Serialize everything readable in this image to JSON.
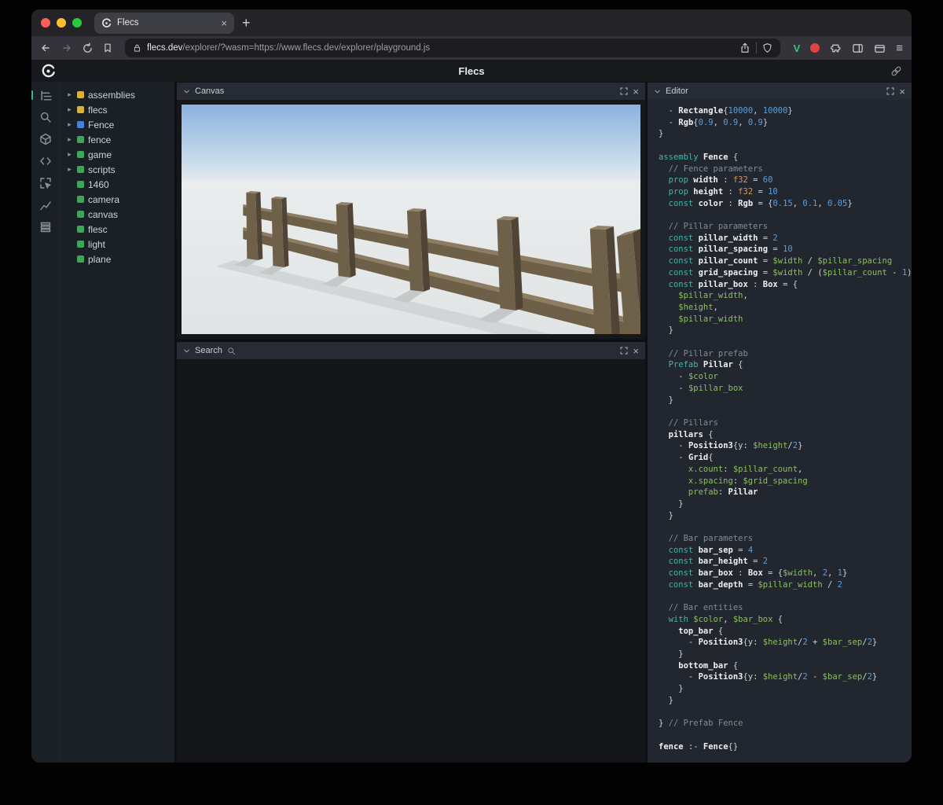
{
  "colors": {
    "traffic_close": "#ff5f57",
    "traffic_min": "#febc2e",
    "traffic_max": "#28c840",
    "keyword": "#45b3a7",
    "variable": "#8cbf5f",
    "number": "#5d9edb",
    "comment": "#848b93",
    "type": "#cf9a5f",
    "plain": "#ccd2d9",
    "bold": "#eef1f4",
    "brave_v_green": "#2ecc71",
    "ext_red": "#e0443e",
    "entity_yellow": "#d8b33c",
    "entity_blue": "#4a80d8",
    "entity_green": "#3fa45c"
  },
  "icons": {
    "tab_close": "×",
    "new_tab": "+",
    "menu": "≡",
    "tree_chevron": "▸",
    "panel_close": "×"
  },
  "browser": {
    "tab_title": "Flecs",
    "url_domain": "flecs.dev",
    "url_path": "/explorer/?wasm=https://www.flecs.dev/explorer/playground.js",
    "ext_v_label": "V"
  },
  "app": {
    "title": "Flecs"
  },
  "sidebar": {
    "icons": [
      "tree-icon",
      "search-icon",
      "entities-icon",
      "code-icon",
      "inspect-icon",
      "stats-icon",
      "queries-icon"
    ]
  },
  "tree": {
    "items": [
      {
        "label": "assemblies",
        "color": "#d8b33c",
        "expandable": true
      },
      {
        "label": "flecs",
        "color": "#d8b33c",
        "expandable": true
      },
      {
        "label": "Fence",
        "color": "#4a80d8",
        "expandable": true
      },
      {
        "label": "fence",
        "color": "#3fa45c",
        "expandable": true
      },
      {
        "label": "game",
        "color": "#3fa45c",
        "expandable": true
      },
      {
        "label": "scripts",
        "color": "#3fa45c",
        "expandable": true
      },
      {
        "label": "1460",
        "color": "#3fa45c",
        "expandable": false
      },
      {
        "label": "camera",
        "color": "#3fa45c",
        "expandable": false
      },
      {
        "label": "canvas",
        "color": "#3fa45c",
        "expandable": false
      },
      {
        "label": "flesc",
        "color": "#3fa45c",
        "expandable": false
      },
      {
        "label": "light",
        "color": "#3fa45c",
        "expandable": false
      },
      {
        "label": "plane",
        "color": "#3fa45c",
        "expandable": false
      }
    ]
  },
  "panels": {
    "canvas": {
      "title": "Canvas"
    },
    "search": {
      "title": "Search"
    },
    "editor": {
      "title": "Editor"
    }
  },
  "editor": {
    "lines": [
      [
        [
          "p",
          "  - "
        ],
        [
          "b",
          "Rectangle"
        ],
        [
          "p",
          "{"
        ],
        [
          "n",
          "10000"
        ],
        [
          "p",
          ", "
        ],
        [
          "n",
          "10000"
        ],
        [
          "p",
          "}"
        ]
      ],
      [
        [
          "p",
          "  - "
        ],
        [
          "b",
          "Rgb"
        ],
        [
          "p",
          "{"
        ],
        [
          "n",
          "0.9"
        ],
        [
          "p",
          ", "
        ],
        [
          "n",
          "0.9"
        ],
        [
          "p",
          ", "
        ],
        [
          "n",
          "0.9"
        ],
        [
          "p",
          "}"
        ]
      ],
      [
        [
          "p",
          "}"
        ]
      ],
      [],
      [
        [
          "k",
          "assembly"
        ],
        [
          "p",
          " "
        ],
        [
          "b",
          "Fence"
        ],
        [
          "p",
          " {"
        ]
      ],
      [
        [
          "c",
          "  // Fence parameters"
        ]
      ],
      [
        [
          "k",
          "  prop"
        ],
        [
          "p",
          " "
        ],
        [
          "b",
          "width"
        ],
        [
          "p",
          " : "
        ],
        [
          "t",
          "f32"
        ],
        [
          "p",
          " = "
        ],
        [
          "n",
          "60"
        ]
      ],
      [
        [
          "k",
          "  prop"
        ],
        [
          "p",
          " "
        ],
        [
          "b",
          "height"
        ],
        [
          "p",
          " : "
        ],
        [
          "t",
          "f32"
        ],
        [
          "p",
          " = "
        ],
        [
          "n",
          "10"
        ]
      ],
      [
        [
          "k",
          "  const"
        ],
        [
          "p",
          " "
        ],
        [
          "b",
          "color"
        ],
        [
          "p",
          " : "
        ],
        [
          "b",
          "Rgb"
        ],
        [
          "p",
          " = {"
        ],
        [
          "n",
          "0.15"
        ],
        [
          "p",
          ", "
        ],
        [
          "n",
          "0.1"
        ],
        [
          "p",
          ", "
        ],
        [
          "n",
          "0.05"
        ],
        [
          "p",
          "}"
        ]
      ],
      [],
      [
        [
          "c",
          "  // Pillar parameters"
        ]
      ],
      [
        [
          "k",
          "  const"
        ],
        [
          "p",
          " "
        ],
        [
          "b",
          "pillar_width"
        ],
        [
          "p",
          " = "
        ],
        [
          "n",
          "2"
        ]
      ],
      [
        [
          "k",
          "  const"
        ],
        [
          "p",
          " "
        ],
        [
          "b",
          "pillar_spacing"
        ],
        [
          "p",
          " = "
        ],
        [
          "n",
          "10"
        ]
      ],
      [
        [
          "k",
          "  const"
        ],
        [
          "p",
          " "
        ],
        [
          "b",
          "pillar_count"
        ],
        [
          "p",
          " = "
        ],
        [
          "v",
          "$width"
        ],
        [
          "p",
          " / "
        ],
        [
          "v",
          "$pillar_spacing"
        ]
      ],
      [
        [
          "k",
          "  const"
        ],
        [
          "p",
          " "
        ],
        [
          "b",
          "grid_spacing"
        ],
        [
          "p",
          " = "
        ],
        [
          "v",
          "$width"
        ],
        [
          "p",
          " / ("
        ],
        [
          "v",
          "$pillar_count"
        ],
        [
          "p",
          " - "
        ],
        [
          "n",
          "1"
        ],
        [
          "p",
          ")"
        ]
      ],
      [
        [
          "k",
          "  const"
        ],
        [
          "p",
          " "
        ],
        [
          "b",
          "pillar_box"
        ],
        [
          "p",
          " : "
        ],
        [
          "b",
          "Box"
        ],
        [
          "p",
          " = {"
        ]
      ],
      [
        [
          "v",
          "    $pillar_width"
        ],
        [
          "p",
          ","
        ]
      ],
      [
        [
          "v",
          "    $height"
        ],
        [
          "p",
          ","
        ]
      ],
      [
        [
          "v",
          "    $pillar_width"
        ]
      ],
      [
        [
          "p",
          "  }"
        ]
      ],
      [],
      [
        [
          "c",
          "  // Pillar prefab"
        ]
      ],
      [
        [
          "k",
          "  Prefab"
        ],
        [
          "p",
          " "
        ],
        [
          "b",
          "Pillar"
        ],
        [
          "p",
          " {"
        ]
      ],
      [
        [
          "p",
          "    - "
        ],
        [
          "v",
          "$color"
        ]
      ],
      [
        [
          "p",
          "    - "
        ],
        [
          "v",
          "$pillar_box"
        ]
      ],
      [
        [
          "p",
          "  }"
        ]
      ],
      [],
      [
        [
          "c",
          "  // Pillars"
        ]
      ],
      [
        [
          "b",
          "  pillars"
        ],
        [
          "p",
          " {"
        ]
      ],
      [
        [
          "p",
          "    - "
        ],
        [
          "b",
          "Position3"
        ],
        [
          "p",
          "{y: "
        ],
        [
          "v",
          "$height"
        ],
        [
          "p",
          "/"
        ],
        [
          "n",
          "2"
        ],
        [
          "p",
          "}"
        ]
      ],
      [
        [
          "p",
          "    - "
        ],
        [
          "b",
          "Grid"
        ],
        [
          "p",
          "{"
        ]
      ],
      [
        [
          "v",
          "      x.count"
        ],
        [
          "p",
          ": "
        ],
        [
          "v",
          "$pillar_count"
        ],
        [
          "p",
          ","
        ]
      ],
      [
        [
          "v",
          "      x.spacing"
        ],
        [
          "p",
          ": "
        ],
        [
          "v",
          "$grid_spacing"
        ]
      ],
      [
        [
          "v",
          "      prefab"
        ],
        [
          "p",
          ": "
        ],
        [
          "b",
          "Pillar"
        ]
      ],
      [
        [
          "p",
          "    }"
        ]
      ],
      [
        [
          "p",
          "  }"
        ]
      ],
      [],
      [
        [
          "c",
          "  // Bar parameters"
        ]
      ],
      [
        [
          "k",
          "  const"
        ],
        [
          "p",
          " "
        ],
        [
          "b",
          "bar_sep"
        ],
        [
          "p",
          " = "
        ],
        [
          "n",
          "4"
        ]
      ],
      [
        [
          "k",
          "  const"
        ],
        [
          "p",
          " "
        ],
        [
          "b",
          "bar_height"
        ],
        [
          "p",
          " = "
        ],
        [
          "n",
          "2"
        ]
      ],
      [
        [
          "k",
          "  const"
        ],
        [
          "p",
          " "
        ],
        [
          "b",
          "bar_box"
        ],
        [
          "p",
          " : "
        ],
        [
          "b",
          "Box"
        ],
        [
          "p",
          " = {"
        ],
        [
          "v",
          "$width"
        ],
        [
          "p",
          ", "
        ],
        [
          "n",
          "2"
        ],
        [
          "p",
          ", "
        ],
        [
          "n",
          "1"
        ],
        [
          "p",
          "}"
        ]
      ],
      [
        [
          "k",
          "  const"
        ],
        [
          "p",
          " "
        ],
        [
          "b",
          "bar_depth"
        ],
        [
          "p",
          " = "
        ],
        [
          "v",
          "$pillar_width"
        ],
        [
          "p",
          " / "
        ],
        [
          "n",
          "2"
        ]
      ],
      [],
      [
        [
          "c",
          "  // Bar entities"
        ]
      ],
      [
        [
          "k",
          "  with"
        ],
        [
          "p",
          " "
        ],
        [
          "v",
          "$color"
        ],
        [
          "p",
          ", "
        ],
        [
          "v",
          "$bar_box"
        ],
        [
          "p",
          " {"
        ]
      ],
      [
        [
          "b",
          "    top_bar"
        ],
        [
          "p",
          " {"
        ]
      ],
      [
        [
          "p",
          "      - "
        ],
        [
          "b",
          "Position3"
        ],
        [
          "p",
          "{y: "
        ],
        [
          "v",
          "$height"
        ],
        [
          "p",
          "/"
        ],
        [
          "n",
          "2"
        ],
        [
          "p",
          " + "
        ],
        [
          "v",
          "$bar_sep"
        ],
        [
          "p",
          "/"
        ],
        [
          "n",
          "2"
        ],
        [
          "p",
          "}"
        ]
      ],
      [
        [
          "p",
          "    }"
        ]
      ],
      [
        [
          "b",
          "    bottom_bar"
        ],
        [
          "p",
          " {"
        ]
      ],
      [
        [
          "p",
          "      - "
        ],
        [
          "b",
          "Position3"
        ],
        [
          "p",
          "{y: "
        ],
        [
          "v",
          "$height"
        ],
        [
          "p",
          "/"
        ],
        [
          "n",
          "2"
        ],
        [
          "p",
          " - "
        ],
        [
          "v",
          "$bar_sep"
        ],
        [
          "p",
          "/"
        ],
        [
          "n",
          "2"
        ],
        [
          "p",
          "}"
        ]
      ],
      [
        [
          "p",
          "    }"
        ]
      ],
      [
        [
          "p",
          "  }"
        ]
      ],
      [],
      [
        [
          "p",
          "} "
        ],
        [
          "c",
          "// Prefab Fence"
        ]
      ],
      [],
      [
        [
          "b",
          "fence"
        ],
        [
          "p",
          " :- "
        ],
        [
          "b",
          "Fence"
        ],
        [
          "p",
          "{}"
        ]
      ]
    ]
  }
}
